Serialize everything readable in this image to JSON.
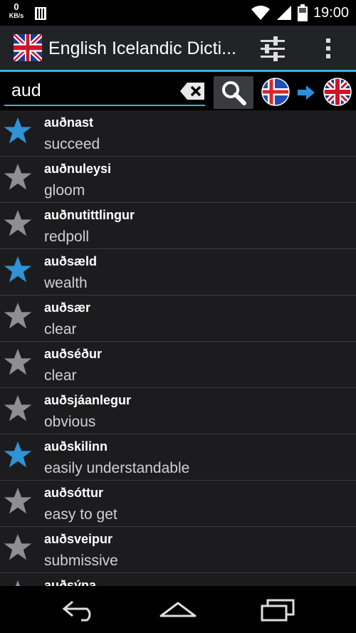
{
  "status_bar": {
    "data_rate": "0",
    "data_rate_unit": "KB/s",
    "time": "19:00",
    "icons": [
      "sim-card-icon",
      "wifi-icon",
      "signal-icon",
      "battery-icon"
    ]
  },
  "action_bar": {
    "title": "English Icelandic Dicti...",
    "icons": [
      "uk-flag-icon",
      "settings-sliders-icon",
      "overflow-menu-icon"
    ]
  },
  "search": {
    "value": "aud",
    "placeholder": "",
    "icons": [
      "clear-text-icon",
      "search-icon"
    ]
  },
  "direction": {
    "from_icon": "iceland-flag-icon",
    "arrow_icon": "arrow-right-icon",
    "to_icon": "uk-flag-icon"
  },
  "colors": {
    "accent": "#33b5e5",
    "star_favorite": "#2f93d4",
    "star_normal": "#8e8e93",
    "list_background": "#1c1c1e"
  },
  "entries": [
    {
      "word": "auðnast",
      "translation": "succeed",
      "favorite": true
    },
    {
      "word": "auðnuleysi",
      "translation": "gloom",
      "favorite": false
    },
    {
      "word": "auðnutittlingur",
      "translation": "redpoll",
      "favorite": false
    },
    {
      "word": "auðsæld",
      "translation": "wealth",
      "favorite": true
    },
    {
      "word": "auðsær",
      "translation": "clear",
      "favorite": false
    },
    {
      "word": "auðséður",
      "translation": "clear",
      "favorite": false
    },
    {
      "word": "auðsjáanlegur",
      "translation": "obvious",
      "favorite": false
    },
    {
      "word": "auðskilinn",
      "translation": "easily understandable",
      "favorite": true
    },
    {
      "word": "auðsóttur",
      "translation": "easy to get",
      "favorite": false
    },
    {
      "word": "auðsveipur",
      "translation": "submissive",
      "favorite": false
    },
    {
      "word": "auðsýna",
      "translation": "",
      "favorite": false
    }
  ],
  "nav_bar": {
    "icons": [
      "back-icon",
      "home-icon",
      "recent-apps-icon"
    ]
  }
}
